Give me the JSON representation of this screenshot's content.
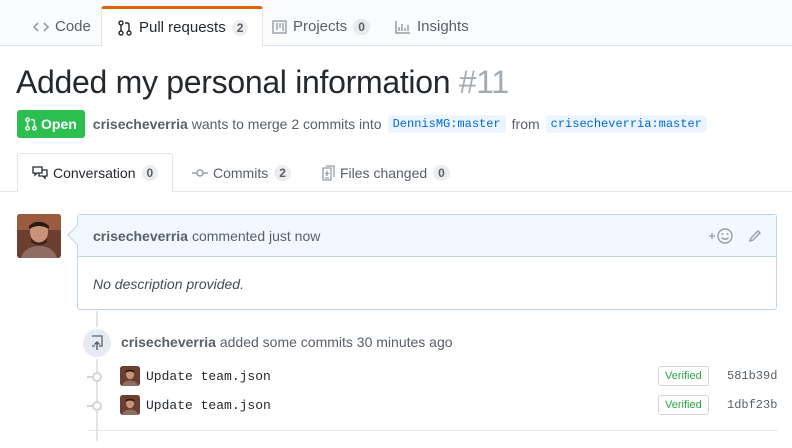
{
  "repo_nav": {
    "tabs": [
      {
        "label": "Code",
        "icon": "code-icon",
        "counter": null
      },
      {
        "label": "Pull requests",
        "icon": "git-pull-request-icon",
        "counter": "2",
        "selected": true
      },
      {
        "label": "Projects",
        "icon": "project-icon",
        "counter": "0"
      },
      {
        "label": "Insights",
        "icon": "graph-icon",
        "counter": null
      }
    ]
  },
  "pr": {
    "title": "Added my personal information",
    "number": "#11",
    "state": "Open",
    "author": "crisecheverria",
    "merge_text_1": "wants to merge 2 commits into",
    "base_branch": "DennisMG:master",
    "from_text": "from",
    "head_branch": "crisecheverria:master"
  },
  "tabs": [
    {
      "label": "Conversation",
      "counter": "0",
      "icon": "comment-discussion-icon",
      "selected": true
    },
    {
      "label": "Commits",
      "counter": "2",
      "icon": "git-commit-icon"
    },
    {
      "label": "Files changed",
      "counter": "0",
      "icon": "diff-icon"
    }
  ],
  "comment": {
    "author": "crisecheverria",
    "action": "commented just now",
    "body": "No description provided."
  },
  "timeline": {
    "author": "crisecheverria",
    "event_text": "added some commits 30 minutes ago",
    "commits": [
      {
        "message": "Update team.json",
        "verified": "Verified",
        "sha": "581b39d"
      },
      {
        "message": "Update team.json",
        "verified": "Verified",
        "sha": "1dbf23b"
      }
    ]
  },
  "colors": {
    "open_green": "#2cbe4e",
    "selected_tab_accent": "#e36209",
    "branch_blue": "#0366d6"
  }
}
